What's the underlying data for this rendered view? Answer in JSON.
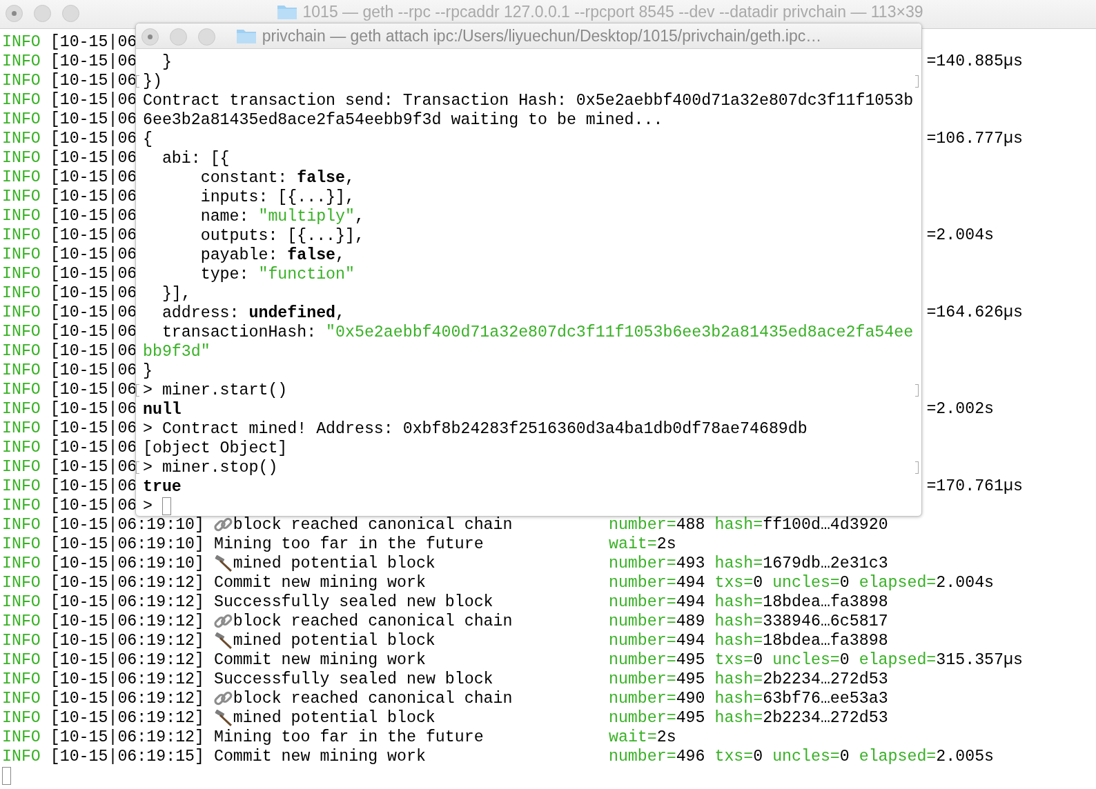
{
  "back_window": {
    "title": "1015 — geth --rpc --rpcaddr 127.0.0.1 --rpcport 8545 --dev --datadir privchain — 113×39",
    "log": [
      {
        "kind": "covered",
        "level": "INFO",
        "time": "[10-15|06"
      },
      {
        "kind": "covered",
        "level": "INFO",
        "time": "[10-15|06",
        "tail": "=140.885µs"
      },
      {
        "kind": "covered",
        "level": "INFO",
        "time": "[10-15|06"
      },
      {
        "kind": "covered",
        "level": "INFO",
        "time": "[10-15|06"
      },
      {
        "kind": "covered",
        "level": "INFO",
        "time": "[10-15|06"
      },
      {
        "kind": "covered",
        "level": "INFO",
        "time": "[10-15|06",
        "tail": "=106.777µs"
      },
      {
        "kind": "covered",
        "level": "INFO",
        "time": "[10-15|06"
      },
      {
        "kind": "covered",
        "level": "INFO",
        "time": "[10-15|06"
      },
      {
        "kind": "covered",
        "level": "INFO",
        "time": "[10-15|06"
      },
      {
        "kind": "covered",
        "level": "INFO",
        "time": "[10-15|06"
      },
      {
        "kind": "covered",
        "level": "INFO",
        "time": "[10-15|06",
        "tail": "=2.004s"
      },
      {
        "kind": "covered",
        "level": "INFO",
        "time": "[10-15|06"
      },
      {
        "kind": "covered",
        "level": "INFO",
        "time": "[10-15|06"
      },
      {
        "kind": "covered",
        "level": "INFO",
        "time": "[10-15|06"
      },
      {
        "kind": "covered",
        "level": "INFO",
        "time": "[10-15|06",
        "tail": "=164.626µs"
      },
      {
        "kind": "covered",
        "level": "INFO",
        "time": "[10-15|06"
      },
      {
        "kind": "covered",
        "level": "INFO",
        "time": "[10-15|06"
      },
      {
        "kind": "covered",
        "level": "INFO",
        "time": "[10-15|06"
      },
      {
        "kind": "covered",
        "level": "INFO",
        "time": "[10-15|06"
      },
      {
        "kind": "covered",
        "level": "INFO",
        "time": "[10-15|06",
        "tail": "=2.002s"
      },
      {
        "kind": "covered",
        "level": "INFO",
        "time": "[10-15|06"
      },
      {
        "kind": "covered",
        "level": "INFO",
        "time": "[10-15|06"
      },
      {
        "kind": "covered",
        "level": "INFO",
        "time": "[10-15|06"
      },
      {
        "kind": "covered",
        "level": "INFO",
        "time": "[10-15|06",
        "tail": "=170.761µs"
      },
      {
        "kind": "covered",
        "level": "INFO",
        "time": "[10-15|06"
      },
      {
        "kind": "chain_message",
        "level": "INFO",
        "time": "[10-15|06:19:10]",
        "message": "block reached canonical chain",
        "fields": [
          {
            "key": "number=",
            "value": "488"
          },
          {
            "key": "hash=",
            "value": "ff100d…4d3920"
          }
        ]
      },
      {
        "kind": "message",
        "level": "INFO",
        "time": "[10-15|06:19:10]",
        "message": "Mining too far in the future",
        "fields": [
          {
            "key": "wait=",
            "value": "2s"
          }
        ]
      },
      {
        "kind": "hammer_message",
        "level": "INFO",
        "time": "[10-15|06:19:10]",
        "message": "mined potential block",
        "fields": [
          {
            "key": "number=",
            "value": "493"
          },
          {
            "key": "hash=",
            "value": "1679db…2e31c3"
          }
        ]
      },
      {
        "kind": "message",
        "level": "INFO",
        "time": "[10-15|06:19:12]",
        "message": "Commit new mining work",
        "fields": [
          {
            "key": "number=",
            "value": "494"
          },
          {
            "key": "txs=",
            "value": "0"
          },
          {
            "key": "uncles=",
            "value": "0"
          },
          {
            "key": "elapsed=",
            "value": "2.004s"
          }
        ]
      },
      {
        "kind": "message",
        "level": "INFO",
        "time": "[10-15|06:19:12]",
        "message": "Successfully sealed new block",
        "fields": [
          {
            "key": "number=",
            "value": "494"
          },
          {
            "key": "hash=",
            "value": "18bdea…fa3898"
          }
        ]
      },
      {
        "kind": "chain_message",
        "level": "INFO",
        "time": "[10-15|06:19:12]",
        "message": "block reached canonical chain",
        "fields": [
          {
            "key": "number=",
            "value": "489"
          },
          {
            "key": "hash=",
            "value": "338946…6c5817"
          }
        ]
      },
      {
        "kind": "hammer_message",
        "level": "INFO",
        "time": "[10-15|06:19:12]",
        "message": "mined potential block",
        "fields": [
          {
            "key": "number=",
            "value": "494"
          },
          {
            "key": "hash=",
            "value": "18bdea…fa3898"
          }
        ]
      },
      {
        "kind": "message",
        "level": "INFO",
        "time": "[10-15|06:19:12]",
        "message": "Commit new mining work",
        "fields": [
          {
            "key": "number=",
            "value": "495"
          },
          {
            "key": "txs=",
            "value": "0"
          },
          {
            "key": "uncles=",
            "value": "0"
          },
          {
            "key": "elapsed=",
            "value": "315.357µs"
          }
        ]
      },
      {
        "kind": "message",
        "level": "INFO",
        "time": "[10-15|06:19:12]",
        "message": "Successfully sealed new block",
        "fields": [
          {
            "key": "number=",
            "value": "495"
          },
          {
            "key": "hash=",
            "value": "2b2234…272d53"
          }
        ]
      },
      {
        "kind": "chain_message",
        "level": "INFO",
        "time": "[10-15|06:19:12]",
        "message": "block reached canonical chain",
        "fields": [
          {
            "key": "number=",
            "value": "490"
          },
          {
            "key": "hash=",
            "value": "63bf76…ee53a3"
          }
        ]
      },
      {
        "kind": "hammer_message",
        "level": "INFO",
        "time": "[10-15|06:19:12]",
        "message": "mined potential block",
        "fields": [
          {
            "key": "number=",
            "value": "495"
          },
          {
            "key": "hash=",
            "value": "2b2234…272d53"
          }
        ]
      },
      {
        "kind": "message",
        "level": "INFO",
        "time": "[10-15|06:19:12]",
        "message": "Mining too far in the future",
        "fields": [
          {
            "key": "wait=",
            "value": "2s"
          }
        ]
      },
      {
        "kind": "message",
        "level": "INFO",
        "time": "[10-15|06:19:15]",
        "message": "Commit new mining work",
        "fields": [
          {
            "key": "number=",
            "value": "496"
          },
          {
            "key": "txs=",
            "value": "0"
          },
          {
            "key": "uncles=",
            "value": "0"
          },
          {
            "key": "elapsed=",
            "value": "2.005s"
          }
        ]
      }
    ]
  },
  "front_window": {
    "title": "privchain — geth attach ipc:/Users/liyuechun/Desktop/1015/privchain/geth.ipc…",
    "lines": [
      {
        "marked": false,
        "cursor": false,
        "segments": [
          {
            "kind": "plain",
            "text": "  }"
          }
        ]
      },
      {
        "marked": true,
        "cursor": false,
        "segments": [
          {
            "kind": "plain",
            "text": "})"
          }
        ]
      },
      {
        "marked": false,
        "cursor": false,
        "segments": [
          {
            "kind": "plain",
            "text": "Contract transaction send: Transaction Hash: 0x5e2aebbf400d71a32e807dc3f11f1053b"
          }
        ]
      },
      {
        "marked": false,
        "cursor": false,
        "segments": [
          {
            "kind": "plain",
            "text": "6ee3b2a81435ed8ace2fa54eebb9f3d waiting to be mined..."
          }
        ]
      },
      {
        "marked": false,
        "cursor": false,
        "segments": [
          {
            "kind": "plain",
            "text": "{"
          }
        ]
      },
      {
        "marked": false,
        "cursor": false,
        "segments": [
          {
            "kind": "plain",
            "text": "  abi: [{"
          }
        ]
      },
      {
        "marked": false,
        "cursor": false,
        "segments": [
          {
            "kind": "plain",
            "text": "      constant: "
          },
          {
            "kind": "keyword",
            "text": "false"
          },
          {
            "kind": "plain",
            "text": ","
          }
        ]
      },
      {
        "marked": false,
        "cursor": false,
        "segments": [
          {
            "kind": "plain",
            "text": "      inputs: [{...}],"
          }
        ]
      },
      {
        "marked": false,
        "cursor": false,
        "segments": [
          {
            "kind": "plain",
            "text": "      name: "
          },
          {
            "kind": "string",
            "text": "\"multiply\""
          },
          {
            "kind": "plain",
            "text": ","
          }
        ]
      },
      {
        "marked": false,
        "cursor": false,
        "segments": [
          {
            "kind": "plain",
            "text": "      outputs: [{...}],"
          }
        ]
      },
      {
        "marked": false,
        "cursor": false,
        "segments": [
          {
            "kind": "plain",
            "text": "      payable: "
          },
          {
            "kind": "keyword",
            "text": "false"
          },
          {
            "kind": "plain",
            "text": ","
          }
        ]
      },
      {
        "marked": false,
        "cursor": false,
        "segments": [
          {
            "kind": "plain",
            "text": "      type: "
          },
          {
            "kind": "string",
            "text": "\"function\""
          }
        ]
      },
      {
        "marked": false,
        "cursor": false,
        "segments": [
          {
            "kind": "plain",
            "text": "  }],"
          }
        ]
      },
      {
        "marked": false,
        "cursor": false,
        "segments": [
          {
            "kind": "plain",
            "text": "  address: "
          },
          {
            "kind": "keyword",
            "text": "undefined"
          },
          {
            "kind": "plain",
            "text": ","
          }
        ]
      },
      {
        "marked": false,
        "cursor": false,
        "segments": [
          {
            "kind": "plain",
            "text": "  transactionHash: "
          },
          {
            "kind": "string",
            "text": "\"0x5e2aebbf400d71a32e807dc3f11f1053b6ee3b2a81435ed8ace2fa54ee"
          }
        ]
      },
      {
        "marked": false,
        "cursor": false,
        "segments": [
          {
            "kind": "string",
            "text": "bb9f3d\""
          }
        ]
      },
      {
        "marked": false,
        "cursor": false,
        "segments": [
          {
            "kind": "plain",
            "text": "}"
          }
        ]
      },
      {
        "marked": true,
        "cursor": false,
        "segments": [
          {
            "kind": "plain",
            "text": "> miner.start()"
          }
        ]
      },
      {
        "marked": false,
        "cursor": false,
        "segments": [
          {
            "kind": "keyword",
            "text": "null"
          }
        ]
      },
      {
        "marked": false,
        "cursor": false,
        "segments": [
          {
            "kind": "plain",
            "text": "> Contract mined! Address: 0xbf8b24283f2516360d3a4ba1db0df78ae74689db"
          }
        ]
      },
      {
        "marked": false,
        "cursor": false,
        "segments": [
          {
            "kind": "plain",
            "text": "[object Object]"
          }
        ]
      },
      {
        "marked": true,
        "cursor": false,
        "segments": [
          {
            "kind": "plain",
            "text": "> miner.stop()"
          }
        ]
      },
      {
        "marked": false,
        "cursor": false,
        "segments": [
          {
            "kind": "keyword",
            "text": "true"
          }
        ]
      },
      {
        "marked": false,
        "cursor": true,
        "segments": [
          {
            "kind": "plain",
            "text": ">"
          }
        ]
      }
    ]
  }
}
